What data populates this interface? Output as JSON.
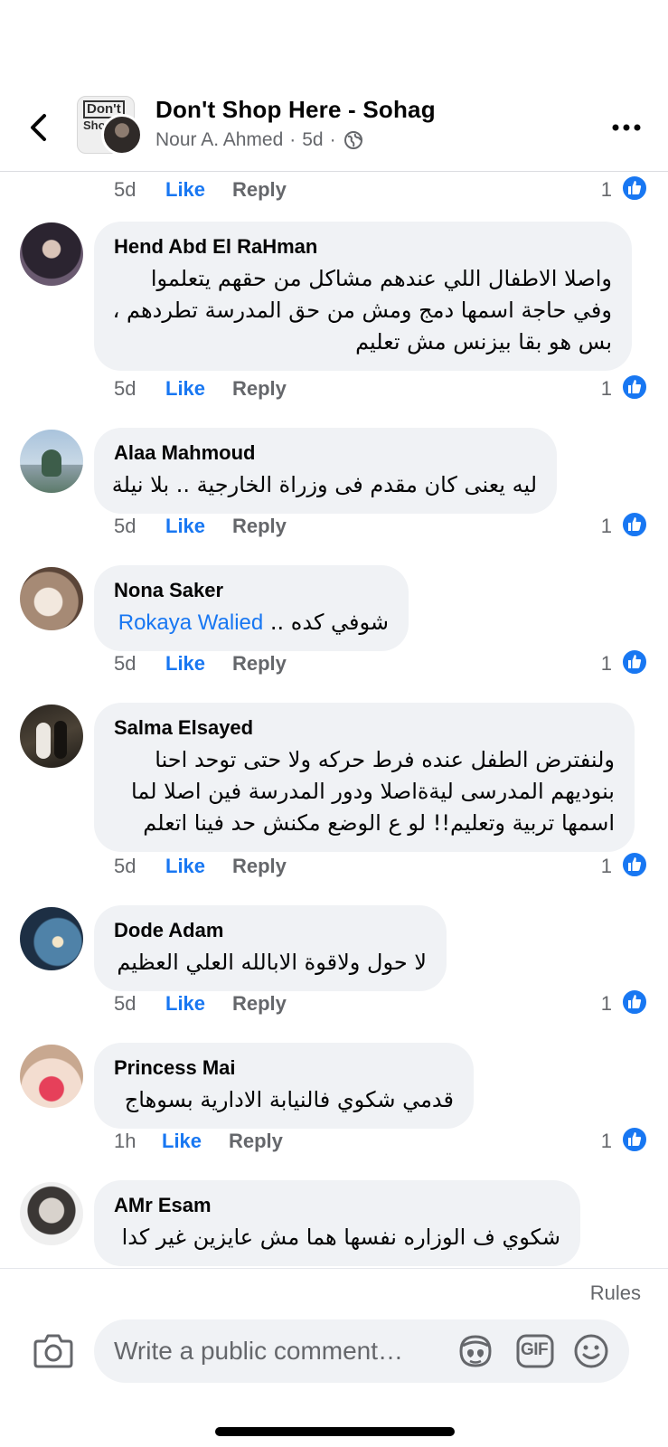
{
  "header": {
    "title": "Don't Shop Here - Sohag",
    "thumb_text": "Don't\nShop\nHere",
    "poster": "Nour A. Ahmed",
    "time": "5d",
    "separator": "·"
  },
  "top_actions": {
    "time": "5d",
    "like": "Like",
    "reply": "Reply",
    "reactions": "1"
  },
  "comments": [
    {
      "author": "Hend Abd El RaHman",
      "lines": [
        "واصلا الاطفال اللي عندهم مشاكل من حقهم يتعلموا",
        "وفي حاجة اسمها دمج ومش من حق المدرسة تطردهم ،",
        "بس هو بقا بيزنس مش تعليم"
      ],
      "time": "5d",
      "like": "Like",
      "reply": "Reply",
      "reactions": "1"
    },
    {
      "author": "Alaa Mahmoud",
      "lines": [
        "ليه يعنى كان مقدم فى وزراة الخارجية .. بلا نيلة"
      ],
      "time": "5d",
      "like": "Like",
      "reply": "Reply",
      "reactions": "1"
    },
    {
      "author": "Nona Saker",
      "text": "شوفي كده ..",
      "mention": "Rokaya Walied",
      "time": "5d",
      "like": "Like",
      "reply": "Reply",
      "reactions": "1"
    },
    {
      "author": "Salma Elsayed",
      "lines": [
        "ولنفترض الطفل عنده فرط حركه ولا حتى توحد احنا",
        "بنوديهم المدرسى ليةةاصلا ودور المدرسة فين اصلا لما",
        "اسمها تربية وتعليم!!  لو ع الوضع مكنش حد فينا اتعلم"
      ],
      "time": "5d",
      "like": "Like",
      "reply": "Reply",
      "reactions": "1"
    },
    {
      "author": "Dode Adam",
      "lines": [
        "لا حول ولاقوة الابالله العلي العظيم"
      ],
      "time": "5d",
      "like": "Like",
      "reply": "Reply",
      "reactions": "1"
    },
    {
      "author": "Princess Mai",
      "lines": [
        "قدمي شكوي فالنيابة الادارية بسوهاج"
      ],
      "time": "1h",
      "like": "Like",
      "reply": "Reply",
      "reactions": "1"
    },
    {
      "author": "AMr Esam",
      "lines": [
        "شكوي ف الوزاره نفسها  هما مش عايزين غير كدا"
      ]
    }
  ],
  "composer": {
    "rules": "Rules",
    "placeholder": "Write a public comment…",
    "gif": "GIF"
  },
  "icons": {
    "back": "chevron-left-icon",
    "more": "more-dots-icon",
    "globe": "globe-icon",
    "like_reaction": "like-thumb-icon",
    "camera": "camera-icon",
    "avatar_sticker": "avatar-sticker-icon",
    "gif": "gif-icon",
    "emoji": "emoji-icon"
  },
  "colors": {
    "accent": "#1877f2",
    "secondary_text": "#65676b",
    "bubble": "#f0f2f5"
  }
}
